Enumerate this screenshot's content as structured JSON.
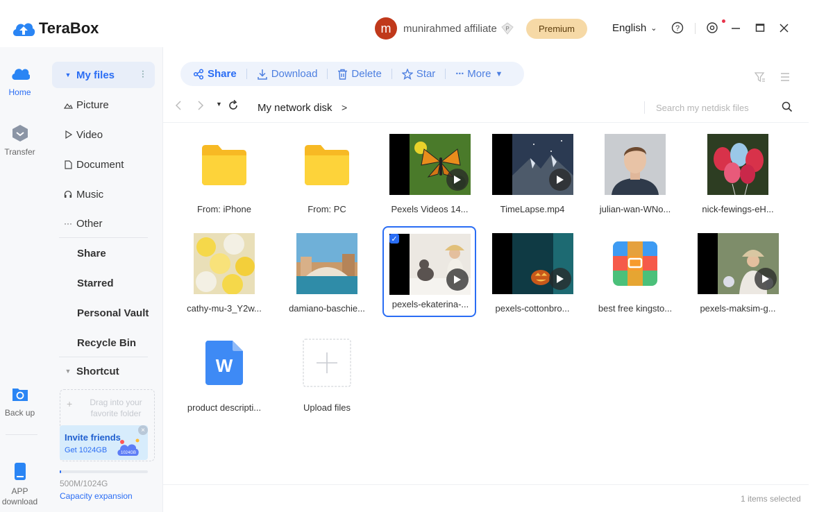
{
  "app": {
    "name": "TeraBox"
  },
  "user": {
    "initial": "m",
    "name": "munirahmed affiliate",
    "badge": "P"
  },
  "header": {
    "premium_label": "Premium",
    "language": "English"
  },
  "rail": [
    {
      "label": "Home",
      "icon": "cloud-icon",
      "active": true
    },
    {
      "label": "Transfer",
      "icon": "transfer-icon"
    },
    {
      "label": "Back up",
      "icon": "backup-icon"
    },
    {
      "label": "APP download",
      "icon": "phone-icon"
    }
  ],
  "sidebar": {
    "my_files": "My files",
    "items": [
      "Picture",
      "Video",
      "Document",
      "Music",
      "Other"
    ],
    "sections": [
      "Share",
      "Starred",
      "Personal Vault",
      "Recycle Bin"
    ],
    "shortcut": "Shortcut",
    "dropzone_text": "Drag into your favorite folder",
    "invite_title": "Invite friends",
    "invite_sub": "Get 1024GB",
    "invite_badge": "1024GB",
    "capacity_text": "500M/1024G",
    "capacity_fraction": 0.0005,
    "capacity_link": "Capacity expansion"
  },
  "toolbar": {
    "share": "Share",
    "download": "Download",
    "delete": "Delete",
    "star": "Star",
    "more": "More"
  },
  "address": {
    "crumb": "My network disk",
    "search_placeholder": "Search my netdisk files"
  },
  "files": [
    {
      "name": "From: iPhone",
      "kind": "folder"
    },
    {
      "name": "From:  PC",
      "kind": "folder"
    },
    {
      "name": "Pexels Videos 14...",
      "kind": "video",
      "thumb": "butterfly"
    },
    {
      "name": "TimeLapse.mp4",
      "kind": "video",
      "thumb": "mountain"
    },
    {
      "name": "julian-wan-WNo...",
      "kind": "image",
      "thumb": "portrait"
    },
    {
      "name": "nick-fewings-eH...",
      "kind": "image",
      "thumb": "balloons"
    },
    {
      "name": "cathy-mu-3_Y2w...",
      "kind": "image",
      "thumb": "fans"
    },
    {
      "name": "damiano-baschie...",
      "kind": "image",
      "thumb": "venice"
    },
    {
      "name": "pexels-ekaterina-...",
      "kind": "video",
      "thumb": "cat",
      "selected": true
    },
    {
      "name": "pexels-cottonbro...",
      "kind": "video",
      "thumb": "pumpkin"
    },
    {
      "name": "best free kingsto...",
      "kind": "archive",
      "thumb": "archive"
    },
    {
      "name": "pexels-maksim-g...",
      "kind": "video",
      "thumb": "woman"
    },
    {
      "name": "product descripti...",
      "kind": "doc",
      "thumb": "word",
      "doc_letter": "W"
    },
    {
      "name": "Upload files",
      "kind": "upload"
    }
  ],
  "status": {
    "selected": "1 items selected"
  },
  "colors": {
    "accent": "#2a6df4",
    "premium_bg": "#f6d9a6",
    "folder": "#fbc531"
  }
}
